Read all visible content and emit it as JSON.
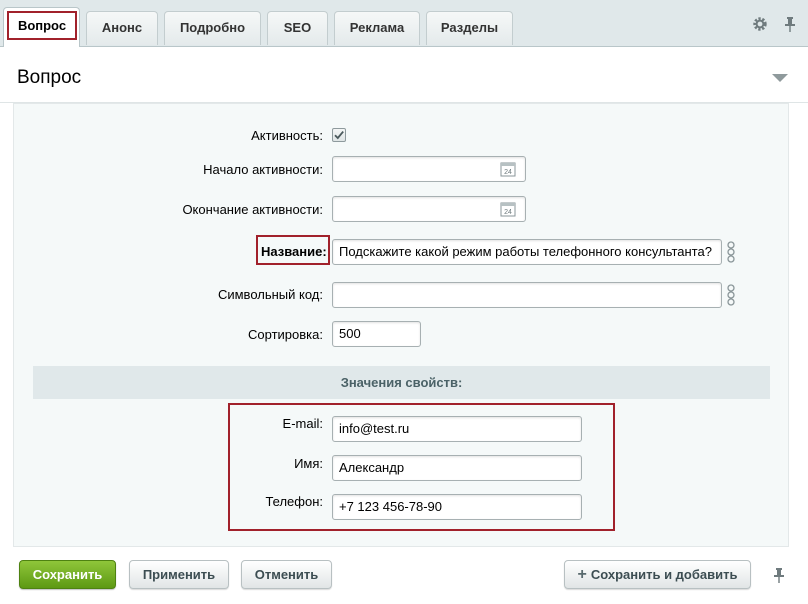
{
  "tabs": [
    {
      "label": "Вопрос",
      "active": true
    },
    {
      "label": "Анонс",
      "active": false
    },
    {
      "label": "Подробно",
      "active": false
    },
    {
      "label": "SEO",
      "active": false
    },
    {
      "label": "Реклама",
      "active": false
    },
    {
      "label": "Разделы",
      "active": false
    }
  ],
  "tab_icons": [
    "gear-icon",
    "pin-icon"
  ],
  "panel": {
    "title": "Вопрос"
  },
  "form": {
    "activity": {
      "label": "Активность:",
      "checked": true
    },
    "active_from": {
      "label": "Начало активности:",
      "value": "",
      "icon": "calendar-icon",
      "icon_text": "24"
    },
    "active_to": {
      "label": "Окончание активности:",
      "value": "",
      "icon": "calendar-icon",
      "icon_text": "24"
    },
    "name": {
      "label": "Название:",
      "value": "Подскажите какой режим работы телефонного консультанта?",
      "icon": "link-icon"
    },
    "code": {
      "label": "Символьный код:",
      "value": "",
      "icon": "link-icon"
    },
    "sort": {
      "label": "Сортировка:",
      "value": "500"
    }
  },
  "properties": {
    "title": "Значения свойств:",
    "email": {
      "label": "E-mail:",
      "value": "info@test.ru"
    },
    "name": {
      "label": "Имя:",
      "value": "Александр"
    },
    "phone": {
      "label": "Телефон:",
      "value": "+7 123 456-78-90"
    }
  },
  "buttons": {
    "save": "Сохранить",
    "apply": "Применить",
    "cancel": "Отменить",
    "save_add": "Сохранить и добавить"
  },
  "colors": {
    "accent_green": "#6aa81d",
    "highlight_red": "#a1212b",
    "tab_bar_bg": "#e0e8ea",
    "form_bg": "#f5f9f9"
  }
}
